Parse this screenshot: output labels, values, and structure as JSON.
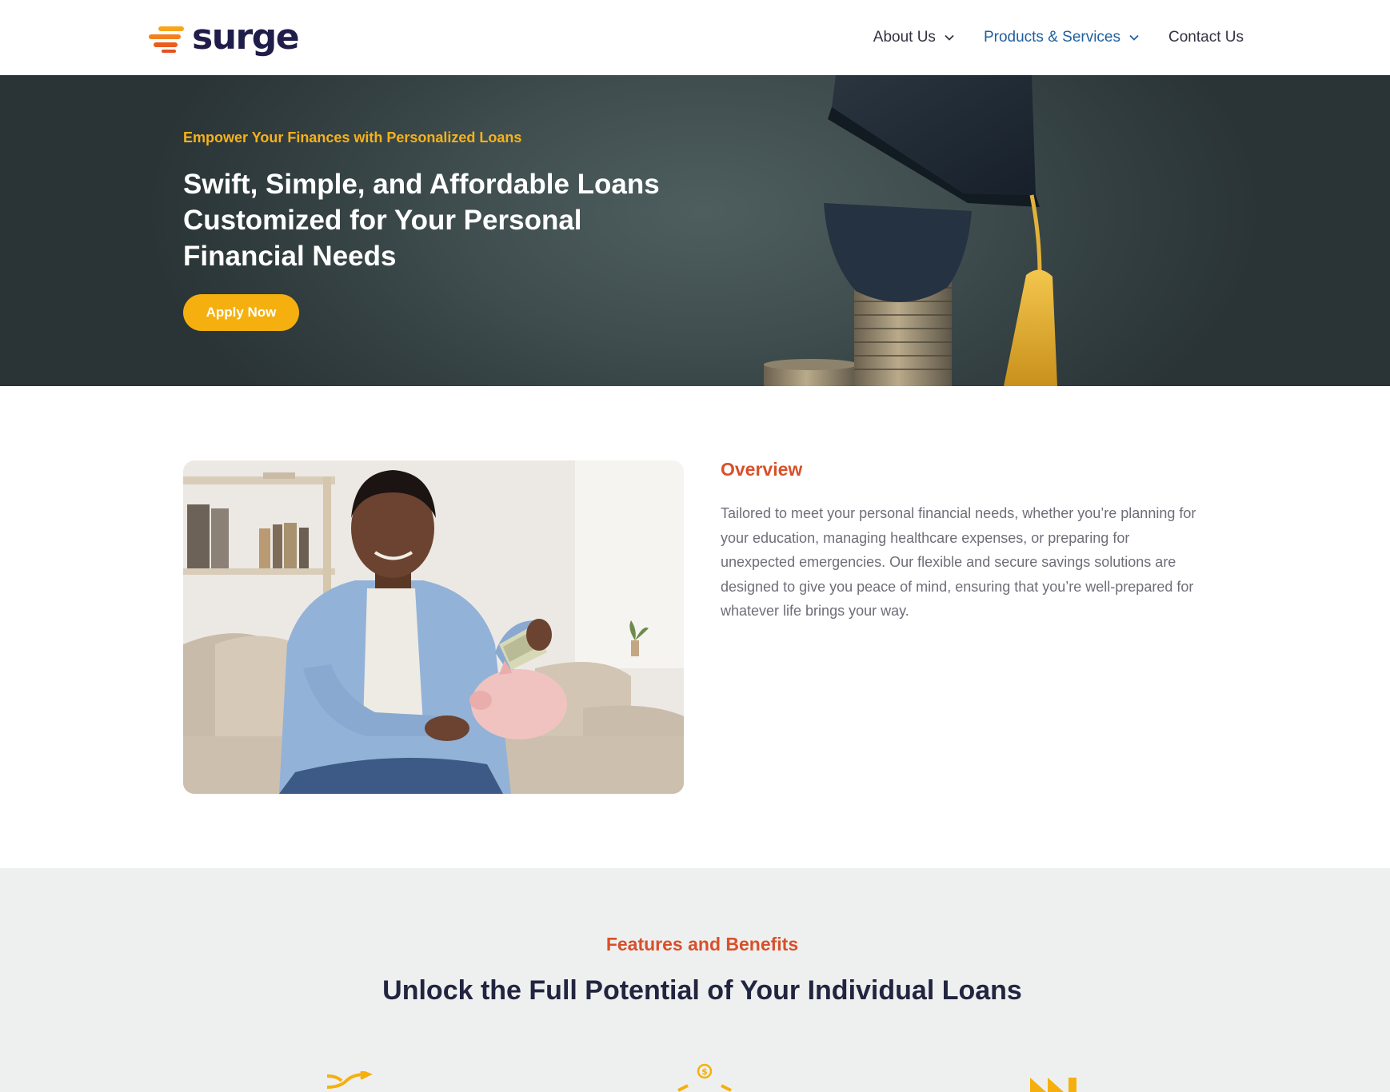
{
  "brand": {
    "name": "surge",
    "orange": "#f36a21",
    "yellow": "#f5b00f",
    "navy": "#1f1d4a"
  },
  "nav": {
    "items": [
      {
        "label": "About Us",
        "has_dropdown": true,
        "active": false
      },
      {
        "label": "Products & Services",
        "has_dropdown": true,
        "active": true
      },
      {
        "label": "Contact Us",
        "has_dropdown": false,
        "active": false
      }
    ]
  },
  "hero": {
    "eyebrow": "Empower Your Finances with Personalized Loans",
    "title": "Swift, Simple, and Affordable Loans Customized for Your Personal Financial Needs",
    "cta_label": "Apply Now"
  },
  "overview": {
    "heading": "Overview",
    "body": "Tailored to meet your personal financial needs, whether you’re planning for your education, managing healthcare expenses, or preparing for unexpected emergencies. Our flexible and secure savings solutions are designed to give you peace of mind, ensuring that you’re well-prepared for whatever life brings your way."
  },
  "features": {
    "eyebrow": "Features and Benefits",
    "title": "Unlock the Full Potential of Your Individual Loans",
    "icons": [
      "shuffle-arrows-icon",
      "coin-growth-icon",
      "fast-forward-icon"
    ]
  }
}
